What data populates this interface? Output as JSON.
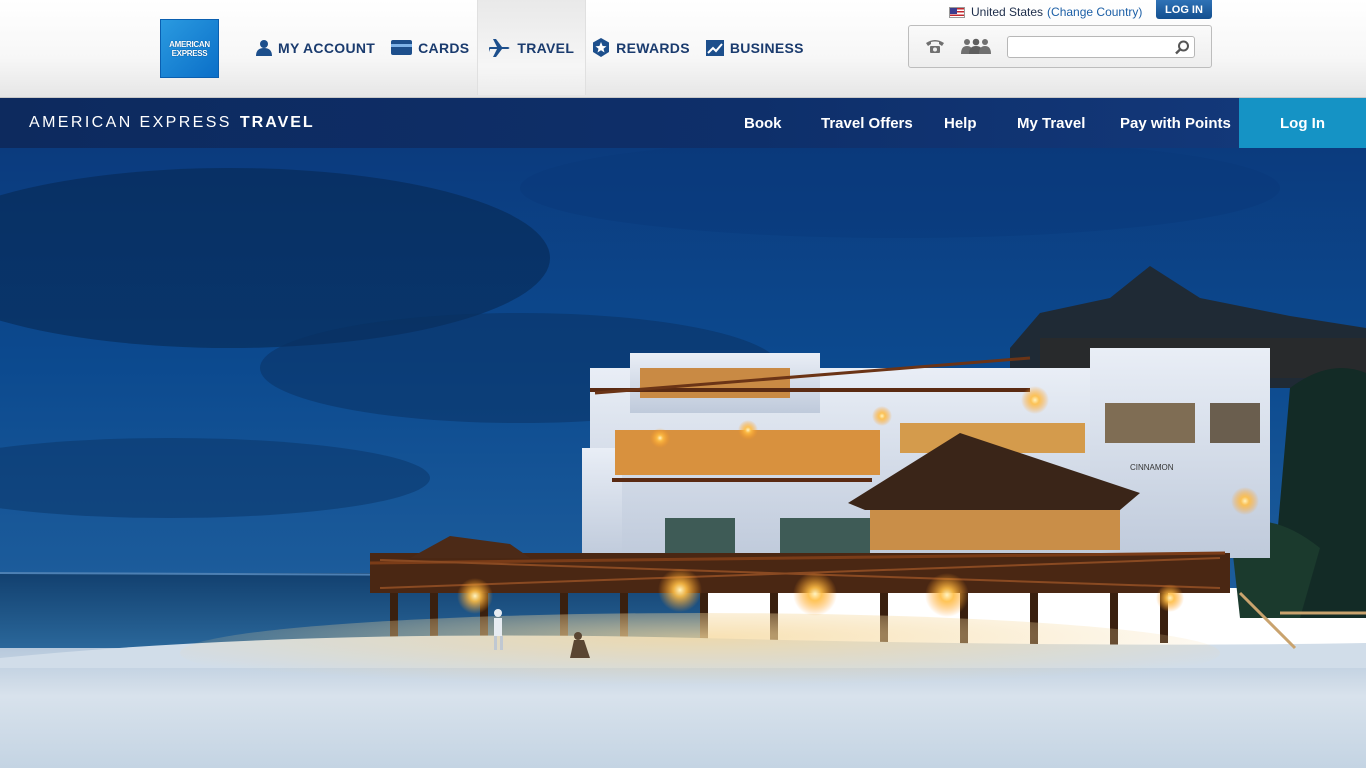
{
  "brand": {
    "logo_line1": "AMERICAN",
    "logo_line2": "EXPRESS"
  },
  "global_nav": {
    "items": [
      {
        "label": "MY ACCOUNT",
        "icon": "user-icon"
      },
      {
        "label": "CARDS",
        "icon": "card-icon"
      },
      {
        "label": "TRAVEL",
        "icon": "airplane-icon",
        "active": true
      },
      {
        "label": "REWARDS",
        "icon": "star-badge-icon"
      },
      {
        "label": "BUSINESS",
        "icon": "chart-icon"
      }
    ]
  },
  "utility": {
    "country": "United States",
    "change_country": "(Change Country)",
    "login": "LOG IN",
    "search_placeholder": "",
    "icons": [
      "phone-icon",
      "people-icon",
      "search-icon"
    ]
  },
  "travel_nav": {
    "brand_regular": "AMERICAN EXPRESS",
    "brand_bold": "TRAVEL",
    "items": [
      "Book",
      "Travel Offers",
      "Help",
      "My Travel",
      "Pay with Points"
    ],
    "login": "Log In"
  },
  "hero": {
    "sign_text": "CINNAMON",
    "colors": {
      "sky": "#0b3a7a",
      "sea": "#1b4f86",
      "sand": "#cfdcea",
      "lights": "#ffb640"
    }
  }
}
